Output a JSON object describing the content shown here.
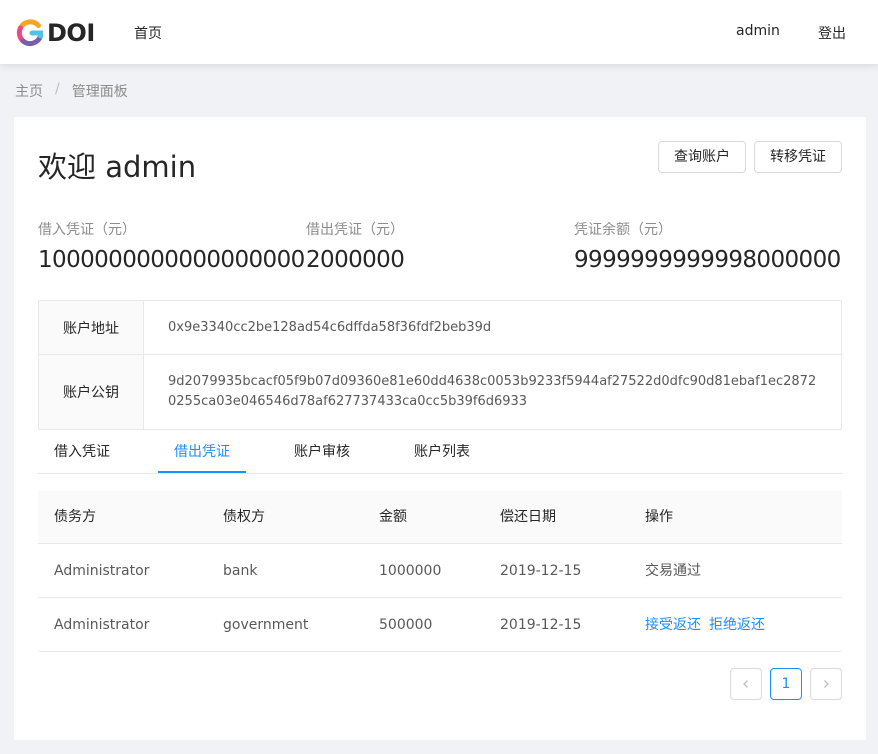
{
  "header": {
    "logo_text": "DOI",
    "nav_home": "首页",
    "user": "admin",
    "logout": "登出"
  },
  "breadcrumb": {
    "items": [
      "主页",
      "管理面板"
    ],
    "separator": "/"
  },
  "welcome": "欢迎 admin",
  "actions": {
    "query_account": "查询账户",
    "transfer_voucher": "转移凭证"
  },
  "stats": [
    {
      "label": "借入凭证（元）",
      "value": "1000000000000000000"
    },
    {
      "label": "借出凭证（元）",
      "value": "2000000"
    },
    {
      "label": "凭证余额（元）",
      "value": "9999999999998000000"
    }
  ],
  "account": {
    "address_label": "账户地址",
    "address": "0x9e3340cc2be128ad54c6dffda58f36fdf2beb39d",
    "pubkey_label": "账户公钥",
    "pubkey": "9d2079935bcacf05f9b07d09360e81e60dd4638c0053b9233f5944af27522d0dfc90d81ebaf1ec28720255ca03e046546d78af627737433ca0cc5b39f6d6933"
  },
  "tabs": [
    {
      "label": "借入凭证",
      "active": false
    },
    {
      "label": "借出凭证",
      "active": true
    },
    {
      "label": "账户审核",
      "active": false
    },
    {
      "label": "账户列表",
      "active": false
    }
  ],
  "table": {
    "columns": [
      "债务方",
      "债权方",
      "金额",
      "偿还日期",
      "操作"
    ],
    "rows": [
      {
        "debtor": "Administrator",
        "creditor": "bank",
        "amount": "1000000",
        "date": "2019-12-15",
        "status": "交易通过"
      },
      {
        "debtor": "Administrator",
        "creditor": "government",
        "amount": "500000",
        "date": "2019-12-15",
        "accept": "接受返还",
        "reject": "拒绝返还"
      }
    ]
  },
  "pagination": {
    "prev_icon": "chevron-left-icon",
    "current": "1",
    "next_icon": "chevron-right-icon"
  },
  "colors": {
    "accent": "#1890ff",
    "background": "#f0f2f5",
    "border": "#e8e8e8"
  }
}
